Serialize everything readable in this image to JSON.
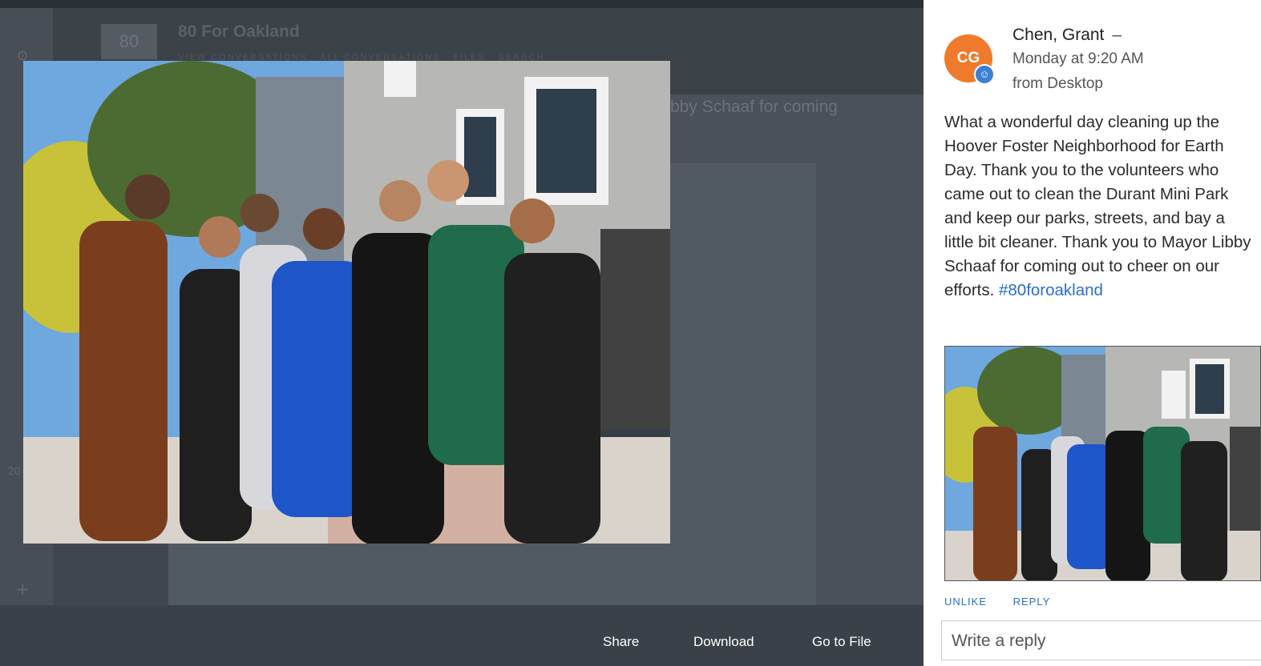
{
  "background": {
    "group_title": "80 For Oakland",
    "tabs": "VIEW CONVERSATIONS · ALL CONVERSATIONS · FILES · SEARCH",
    "post_snippet": "bby Schaaf for coming",
    "logo_text": "80 for Oakland",
    "rail_number": "20"
  },
  "toolbar": {
    "share_label": "Share",
    "download_label": "Download",
    "goto_label": "Go to File"
  },
  "post": {
    "avatar_initials": "CG",
    "author": "Chen, Grant",
    "dash": "–",
    "time": "Monday at 9:20 AM",
    "source": "from Desktop",
    "body": "What a wonderful day cleaning up the Hoover Foster Neighborhood for Earth Day. Thank you to the volunteers who came out to clean the Durant Mini Park and keep our parks, streets, and bay a little bit cleaner. Thank you to Mayor Libby Schaaf for coming out to cheer on our efforts.",
    "hashtag": "#80foroakland",
    "unlike_label": "UNLIKE",
    "reply_label": "REPLY"
  },
  "reply": {
    "placeholder": "Write a reply"
  },
  "colors": {
    "avatar": "#f07a2b",
    "link": "#2a6fc9",
    "overlay": "#3a4149"
  },
  "icons": {
    "avatar_badge": "smiley-icon",
    "rail_top": "gear-icon",
    "rail_bottom": "plus-icon"
  }
}
